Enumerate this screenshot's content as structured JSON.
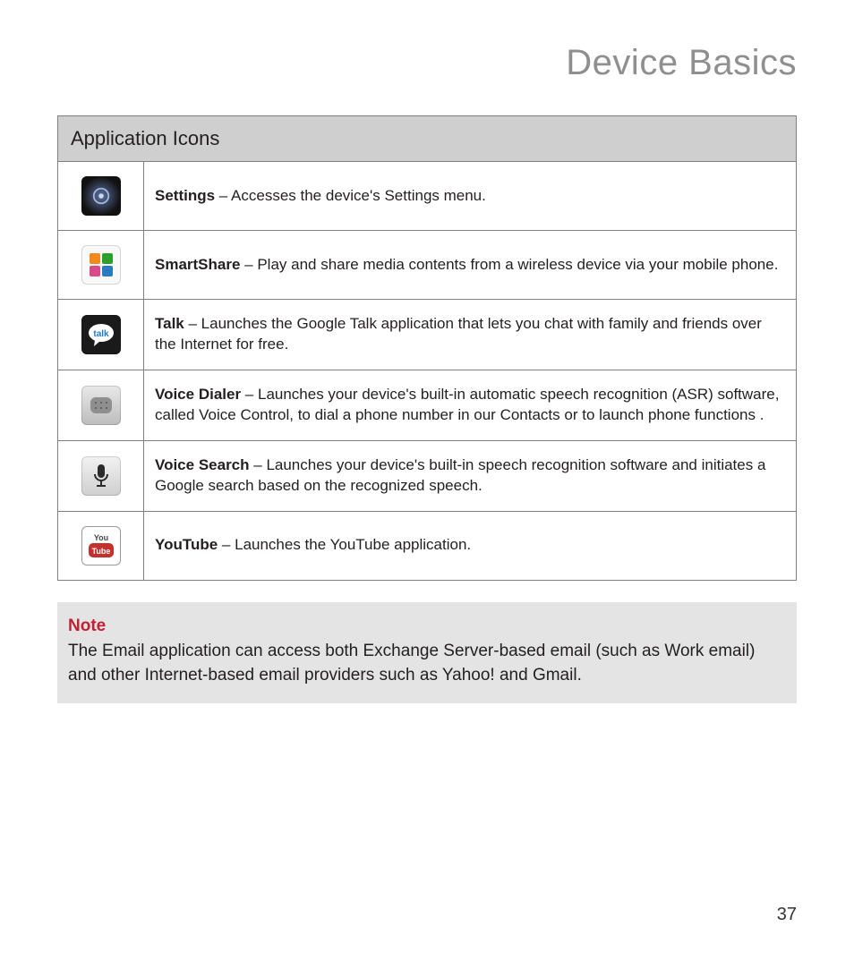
{
  "page_title": "Device Basics",
  "table_header": "Application Icons",
  "rows": [
    {
      "icon": "settings-icon",
      "name": "Settings",
      "sep": " – ",
      "desc": "Accesses the device's Settings menu."
    },
    {
      "icon": "smartshare-icon",
      "name": "SmartShare",
      "sep": " – ",
      "desc": "Play and share media contents from a wireless device via your mobile phone."
    },
    {
      "icon": "talk-icon",
      "name": "Talk",
      "sep": " – ",
      "desc": "Launches the Google Talk application that lets you chat with family and friends over the Internet for free."
    },
    {
      "icon": "voice-dialer-icon",
      "name": "Voice Dialer",
      "sep": " – ",
      "desc": "Launches your device's built-in automatic speech recognition (ASR) software, called Voice Control, to dial a phone number in our Contacts or to launch phone functions ."
    },
    {
      "icon": "voice-search-icon",
      "name": "Voice Search",
      "sep": " – ",
      "desc": "Launches your device's built-in speech recognition software and initiates a Google search based on the recognized speech."
    },
    {
      "icon": "youtube-icon",
      "name": "YouTube",
      "sep": " – ",
      "desc": "Launches the YouTube application."
    }
  ],
  "note": {
    "label": "Note",
    "text": "The Email application can access both Exchange Server-based email (such as Work email) and other Internet-based email providers such as Yahoo! and Gmail."
  },
  "page_number": "37"
}
